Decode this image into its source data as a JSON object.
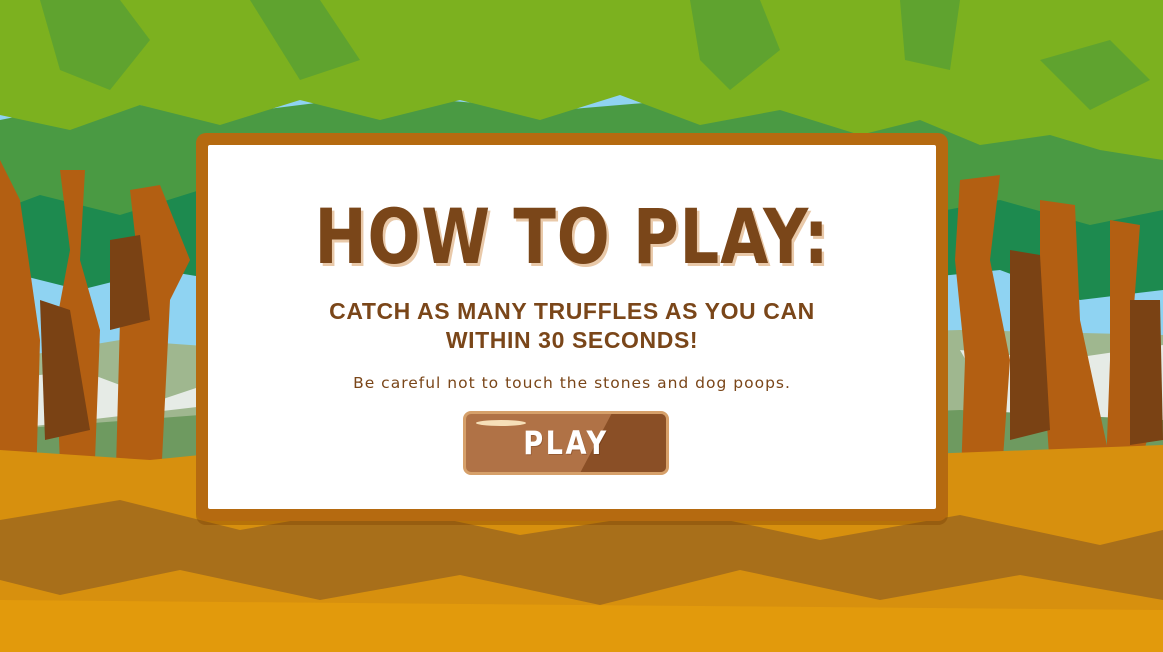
{
  "game": {
    "colors": {
      "sky": "#8fd3f2",
      "canopy_light": "#7cb11f",
      "canopy_mid": "#4a9a43",
      "canopy_dark": "#1d8a4f",
      "trunk": "#b35f12",
      "trunk_dark": "#7a4214",
      "ground": "#d7900e",
      "modal_border": "#b56a10",
      "text_brown": "#7a4619",
      "button": "#b07246"
    }
  },
  "modal": {
    "title": "HOW TO PLAY:",
    "subtitle": "CATCH AS MANY TRUFFLES AS YOU CAN WITHIN 30 SECONDS!",
    "hint": "Be careful not to touch the stones and dog poops.",
    "play_label": "PLAY"
  }
}
